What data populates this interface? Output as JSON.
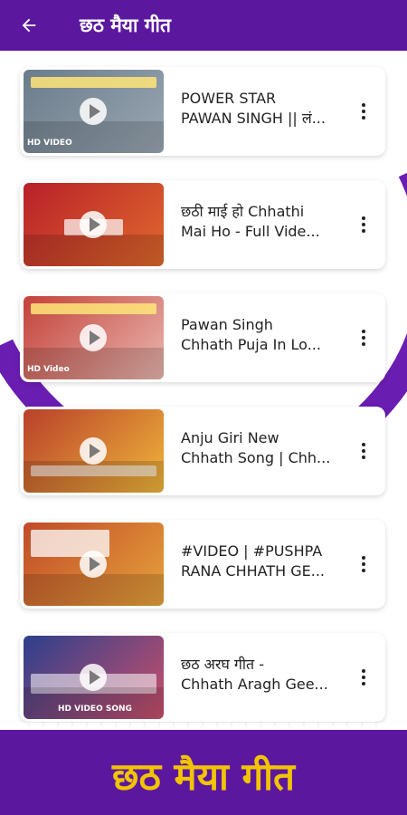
{
  "header": {
    "back_icon": "arrow-left-icon",
    "title": "छठ मैया गीत",
    "bg_color": "#5b189f"
  },
  "videos": [
    {
      "line1": "POWER STAR",
      "line2": "PAWAN SINGH || लं...",
      "thumb_colors": [
        "#6b7c8a",
        "#9aa7b3"
      ],
      "badge": "HD VIDEO"
    },
    {
      "line1": "छठी माई हो Chhathi",
      "line2": "Mai Ho - Full Vide...",
      "thumb_colors": [
        "#b8202a",
        "#e06a2c"
      ],
      "badge": ""
    },
    {
      "line1": "Pawan Singh",
      "line2": "Chhath Puja In Lo...",
      "thumb_colors": [
        "#c3423a",
        "#e9b7b0"
      ],
      "badge": "HD Video"
    },
    {
      "line1": "Anju Giri New",
      "line2": "Chhath Song | Chh...",
      "thumb_colors": [
        "#b8402b",
        "#f0b63a"
      ],
      "badge": ""
    },
    {
      "line1": "#VIDEO | #PUSHPA",
      "line2": "RANA CHHATH GE...",
      "thumb_colors": [
        "#c04a28",
        "#e7a33c"
      ],
      "badge": ""
    },
    {
      "line1": "छठ अरघ गीत -",
      "line2": "Chhath Aragh Gee...",
      "thumb_colors": [
        "#2d3f8d",
        "#c9506a"
      ],
      "badge": "HD VIDEO SONG"
    }
  ],
  "banner": {
    "text": "छठ मैया गीत",
    "text_color": "#f2c400"
  },
  "more_icon": "more-vertical-icon",
  "play_icon": "play-icon"
}
